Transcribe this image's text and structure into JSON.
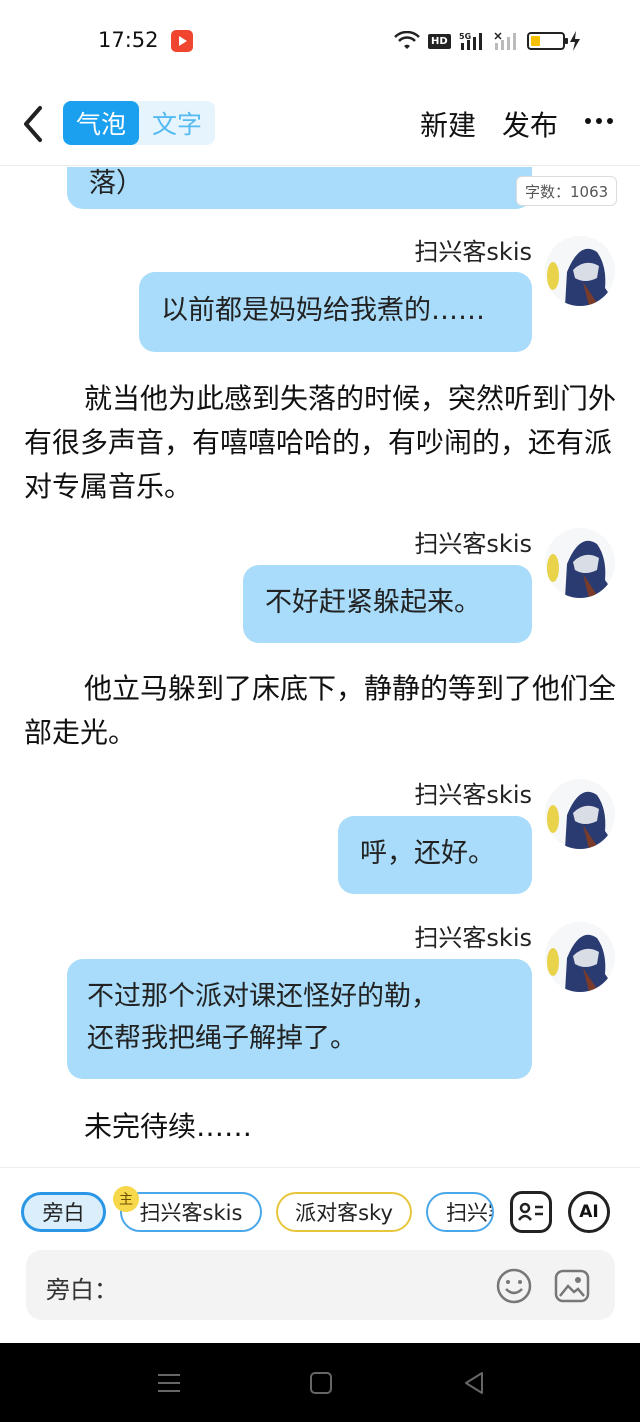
{
  "status_bar": {
    "time": "17:52",
    "network": "5G",
    "hd_label": "HD"
  },
  "header": {
    "mode_bubble": "气泡",
    "mode_text": "文字",
    "new_label": "新建",
    "publish_label": "发布"
  },
  "word_count": "字数：1063",
  "story": {
    "top_bubble_tail": "落）",
    "m1_sender": "扫兴客skis",
    "m1_text": "以前都是妈妈给我煮的……",
    "n1": "就当他为此感到失落的时候，突然听到门外有很多声音，有嘻嘻哈哈的，有吵闹的，还有派对专属音乐。",
    "m2_sender": "扫兴客skis",
    "m2_text": "不好赶紧躲起来。",
    "n2": "他立马躲到了床底下，静静的等到了他们全部走光。",
    "m3_sender": "扫兴客skis",
    "m3_text": "呼，还好。",
    "m4_sender": "扫兴客skis",
    "m4_line1": "不过那个派对课还怪好的勒，",
    "m4_line2": "还帮我把绳子解掉了。",
    "ending": "未完待续……"
  },
  "roles": {
    "narration": "旁白",
    "host_badge": "主",
    "role_a": "扫兴客skis",
    "role_b": "派对客sky",
    "role_c": "扫兴客skis",
    "ai_label": "AI"
  },
  "input": {
    "label": "旁白："
  },
  "colors": {
    "accent": "#1ba0ef",
    "bubble": "#a8dcfa",
    "chip_blue": "#4aa8ea",
    "chip_yellow": "#e7c63c"
  }
}
